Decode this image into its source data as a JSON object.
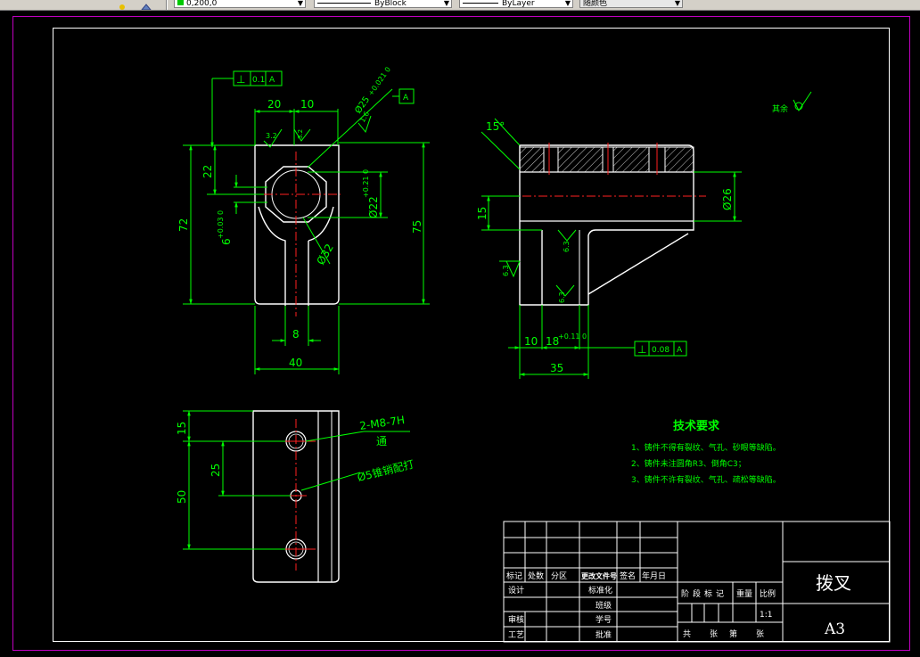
{
  "toolbar": {
    "color_combo": "0,200,0",
    "linetype_combo": "ByBlock",
    "lineweight_combo": "ByLayer",
    "plotstyle_combo": "随颜色"
  },
  "part_view": {
    "perp_tol_top": "⊥",
    "perp_tol_top_value": "0.1",
    "perp_tol_top_ref": "A",
    "datum_a": "A",
    "dim_20": "20",
    "dim_10": "10",
    "dim_phi25": "Ø25",
    "dim_phi25_tol": "+0.021 0",
    "rough_32": "3.2",
    "rough_16": "1.6",
    "rough_16b": "3.2",
    "dim_22": "22",
    "dim_72": "72",
    "dim_6": "6",
    "dim_6_tol": "+0.03 0",
    "dim_phi22": "Ø22",
    "dim_phi22_tol": "+0.21 0",
    "dim_phi32": "Ø32",
    "dim_75": "75",
    "dim_8": "8",
    "dim_40": "40"
  },
  "side_view": {
    "angle_15": "15°",
    "dim_15": "15",
    "dim_phi26": "Ø26",
    "rough_63": "6.3",
    "rough_63b": "6.3",
    "rough_63c": "6.3",
    "dim_10": "10",
    "dim_18": "18",
    "dim_18_tol": "+0.11 0",
    "dim_35": "35",
    "perp_tol": "⊥",
    "perp_tol_value": "0.08",
    "perp_tol_ref": "A",
    "rest_label": "其余"
  },
  "bottom_view": {
    "dim_15": "15",
    "dim_25": "25",
    "dim_50": "50",
    "label_thread": "2-M8-7H",
    "label_through": "通",
    "label_pin": "Ø5锥销配打"
  },
  "tech_req": {
    "title": "技术要求",
    "lines": [
      "1、铸件不得有裂纹、气孔、砂眼等缺陷。",
      "2、铸件未注圆角R3、倒角C3；",
      "3、铸件不许有裂纹、气孔、疏松等缺陷。"
    ]
  },
  "title_block": {
    "part_name": "拨叉",
    "sheet_size": "A3",
    "scale": "1:1",
    "headers": [
      "标记",
      "处数",
      "分区",
      "更改文件号",
      "签名",
      "年月日"
    ],
    "row_design": "设计",
    "row_standard": "标准化",
    "row_grade": "班级",
    "row_check": "审核",
    "row_student_no": "学号",
    "row_process": "工艺",
    "row_approve": "批准",
    "stage_marks": "阶段标记",
    "weight": "重量",
    "ratio": "比例",
    "sheet_count": "共",
    "sheet_unit": "张",
    "sheet_num": "第",
    "sheet_unit2": "张"
  },
  "colors": {
    "background": "#000000",
    "geometry": "#ffffff",
    "dimension": "#00ff00",
    "centerline": "#ff2020",
    "hatch": "#ffffff",
    "frame": "#c000c0"
  }
}
